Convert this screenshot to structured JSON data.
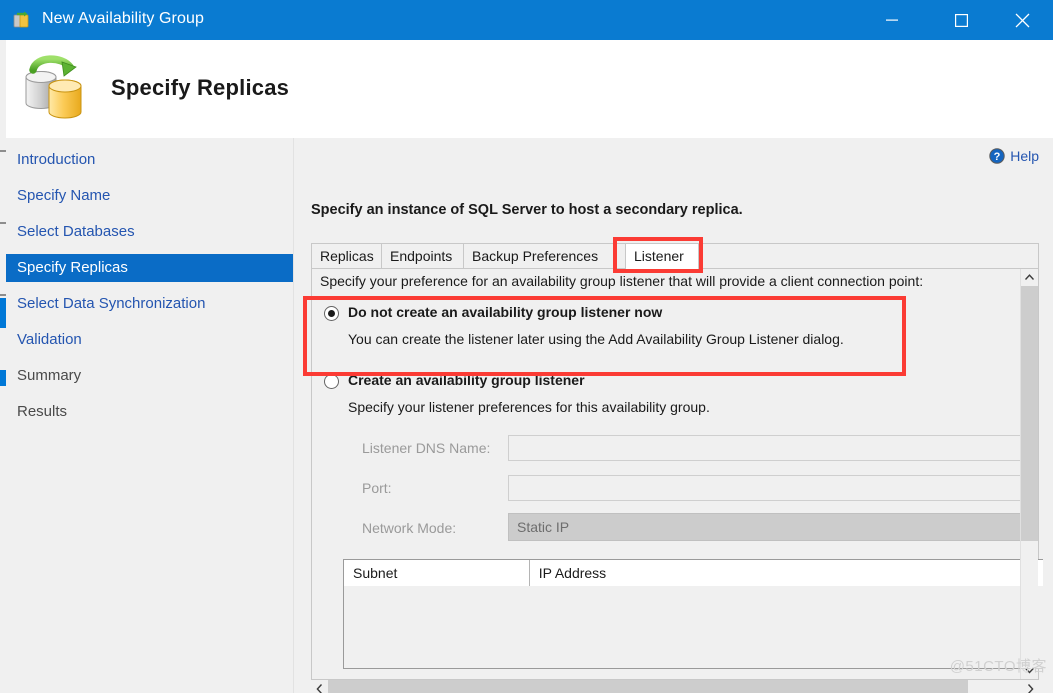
{
  "window": {
    "title": "New Availability Group",
    "icon": "availability-group-icon",
    "controls": {
      "minimize": "minimize-icon",
      "maximize": "maximize-icon",
      "close": "close-icon"
    }
  },
  "header": {
    "title": "Specify Replicas",
    "icon": "database-replication-icon"
  },
  "sidebar": {
    "items": [
      {
        "label": "Introduction",
        "state": "link"
      },
      {
        "label": "Specify Name",
        "state": "link"
      },
      {
        "label": "Select Databases",
        "state": "link"
      },
      {
        "label": "Specify Replicas",
        "state": "active"
      },
      {
        "label": "Select Data Synchronization",
        "state": "link"
      },
      {
        "label": "Validation",
        "state": "link"
      },
      {
        "label": "Summary",
        "state": "disabled"
      },
      {
        "label": "Results",
        "state": "disabled"
      }
    ]
  },
  "content": {
    "help_label": "Help",
    "help_icon": "help-question-icon",
    "instruction": "Specify an instance of SQL Server to host a secondary replica.",
    "tabs": [
      {
        "label": "Replicas",
        "selected": false
      },
      {
        "label": "Endpoints",
        "selected": false
      },
      {
        "label": "Backup Preferences",
        "selected": false
      },
      {
        "label": "Listener",
        "selected": true
      }
    ],
    "panel": {
      "note": "Specify your preference for an availability group listener that will provide a client connection point:",
      "options": [
        {
          "label": "Do not create an availability group listener now",
          "description": "You can create the listener later using the Add Availability Group Listener dialog.",
          "checked": true
        },
        {
          "label": "Create an availability group listener",
          "description": "Specify your listener preferences for this availability group.",
          "checked": false
        }
      ],
      "fields": [
        {
          "label": "Listener DNS Name:",
          "value": "",
          "type": "text",
          "disabled": true
        },
        {
          "label": "Port:",
          "value": "",
          "type": "text",
          "disabled": true
        },
        {
          "label": "Network Mode:",
          "value": "Static IP",
          "type": "combo",
          "disabled": true
        }
      ],
      "grid": {
        "columns": [
          "Subnet",
          "IP Address"
        ],
        "rows": []
      }
    }
  },
  "colors": {
    "titlebar": "#0a7bd1",
    "sidebar_active": "#0a6cc6",
    "link": "#2455b0",
    "annotation": "#fb3b34",
    "combo_disabled_bg": "#cccccc"
  },
  "watermark": "@51CTO博客"
}
